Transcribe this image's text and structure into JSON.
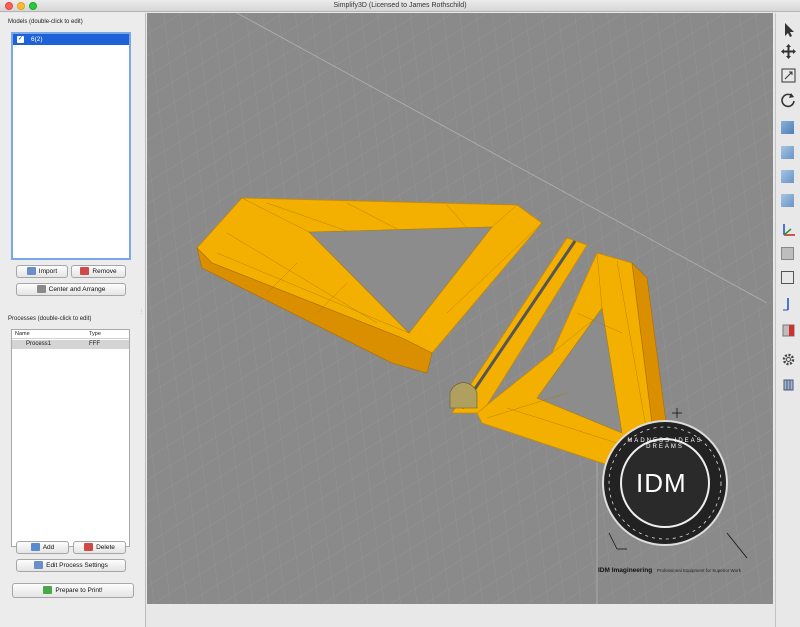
{
  "window": {
    "title": "Simplify3D (Licensed to James Rothschild)"
  },
  "models": {
    "label": "Models (double-click to edit)",
    "items": [
      {
        "name": "6(2)",
        "checked": true
      }
    ],
    "import_label": "Import",
    "remove_label": "Remove",
    "center_label": "Center and Arrange"
  },
  "processes": {
    "label": "Processes (double-click to edit)",
    "col_name": "Name",
    "col_type": "Type",
    "rows": [
      {
        "name": "Process1",
        "type": "FFF"
      }
    ],
    "add_label": "Add",
    "delete_label": "Delete",
    "edit_label": "Edit Process Settings"
  },
  "prepare_label": "Prepare to Print!",
  "watermark": {
    "logo_text": "IDM",
    "ring_text": "MADNESS IDEAS DREAMS",
    "company": "IDM Imagineering",
    "tagline": "Professional Equipment for Superior Work"
  },
  "toolbar_icons": [
    "select-icon",
    "move-icon",
    "scale-icon",
    "rotate-icon",
    "view-cube-icon",
    "view-front-icon",
    "view-side-icon",
    "view-top-icon",
    "axes-icon",
    "solid-cube-icon",
    "wireframe-cube-icon",
    "axis-z-icon",
    "cross-section-icon",
    "settings-gear-icon",
    "layer-icon"
  ],
  "colors": {
    "model": "#f7b500",
    "selection": "#1e62d8",
    "grid_bg": "#8a8a8a"
  }
}
